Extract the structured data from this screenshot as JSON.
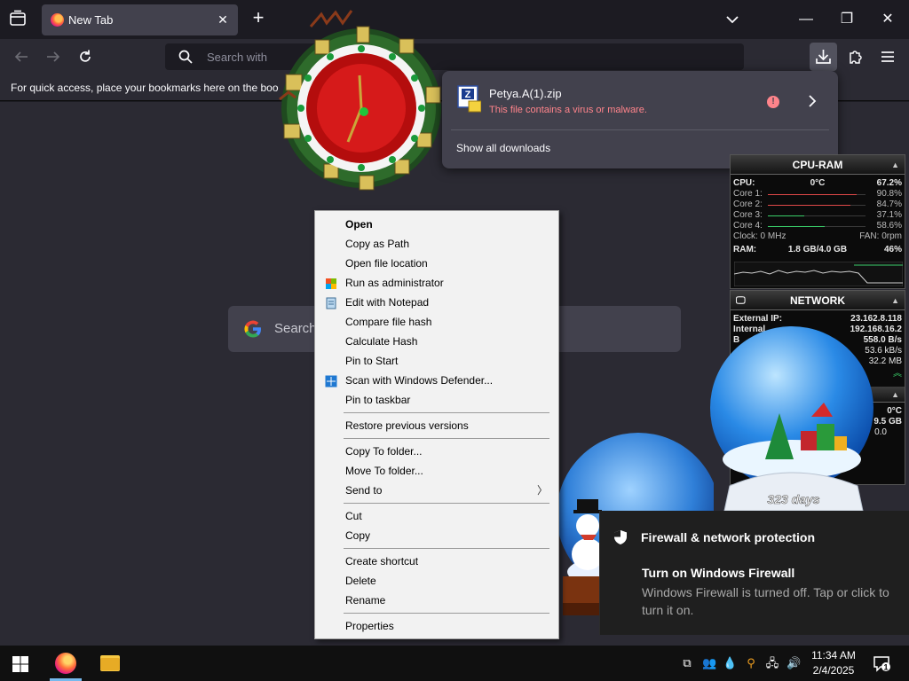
{
  "browser": {
    "tab_title": "New Tab",
    "tab_close": "✕",
    "new_tab": "+",
    "window_controls": {
      "minimize": "—",
      "maximize": "❐",
      "close": "✕"
    },
    "url_placeholder": "Search with",
    "bookmarks_message": "For quick access, place your bookmarks here on the boo",
    "google_search_placeholder": "Search"
  },
  "downloads_panel": {
    "file_name": "Petya.A(1).zip",
    "status": "This file contains a virus or malware.",
    "warn_glyph": "!",
    "show_all": "Show all downloads"
  },
  "context_menu": {
    "items": [
      {
        "label": "Open",
        "bold": true
      },
      {
        "label": "Copy as Path"
      },
      {
        "label": "Open file location"
      },
      {
        "label": "Run as administrator",
        "icon": "shield-icon"
      },
      {
        "label": "Edit with Notepad",
        "icon": "notepad-icon"
      },
      {
        "label": "Compare file hash"
      },
      {
        "label": "Calculate Hash"
      },
      {
        "label": "Pin to Start"
      },
      {
        "label": "Scan with Windows Defender...",
        "icon": "defender-icon"
      },
      {
        "label": "Pin to taskbar"
      },
      {
        "label": "Restore previous versions"
      },
      {
        "label": "Copy To folder..."
      },
      {
        "label": "Move To folder..."
      },
      {
        "label": "Send to",
        "submenu": true
      },
      {
        "label": "Cut"
      },
      {
        "label": "Copy"
      },
      {
        "label": "Create shortcut"
      },
      {
        "label": "Delete"
      },
      {
        "label": "Rename"
      },
      {
        "label": "Properties"
      }
    ],
    "submenu_arrow": "〉"
  },
  "cpu_gadget": {
    "title": "CPU-RAM",
    "cpu_label": "CPU:",
    "cpu_temp": "0°C",
    "cpu_value": "67.2%",
    "cores": [
      {
        "label": "Core 1:",
        "value": "90.8%",
        "fraction": 0.908,
        "color": "#e04848"
      },
      {
        "label": "Core 2:",
        "value": "84.7%",
        "fraction": 0.847,
        "color": "#e04848"
      },
      {
        "label": "Core 3:",
        "value": "37.1%",
        "fraction": 0.371,
        "color": "#3ad06a"
      },
      {
        "label": "Core 4:",
        "value": "58.6%",
        "fraction": 0.586,
        "color": "#3ad06a"
      }
    ],
    "clock": "Clock: 0 MHz",
    "fan": "FAN: 0rpm",
    "ram_label": "RAM:",
    "ram_value": "1.8 GB/4.0 GB",
    "ram_percent": "46%"
  },
  "net_gadget": {
    "title": "NETWORK",
    "external_ip_label": "External IP:",
    "external_ip": "23.162.8.118",
    "internal_label": "Internal",
    "internal_ip": "192.168.16.2",
    "row3_label": "B",
    "row3_value": "558.0 B/s",
    "row4_value": "53.6 kB/s",
    "row5_value": "32.2 MB",
    "temp": "0°C",
    "disk": "9.5 GB",
    "disk_small": "0.0"
  },
  "snow_globe": {
    "days_text": "323 days"
  },
  "toast": {
    "app": "Firewall & network protection",
    "title": "Turn on Windows Firewall",
    "body": "Windows Firewall is turned off. Tap or click to turn it on."
  },
  "taskbar": {
    "time": "11:34 AM",
    "date": "2/4/2025",
    "notification_count": "1"
  },
  "colors": {
    "accent_download": "#52525e",
    "virus_red": "#ff848b",
    "taskbar": "#101010"
  }
}
